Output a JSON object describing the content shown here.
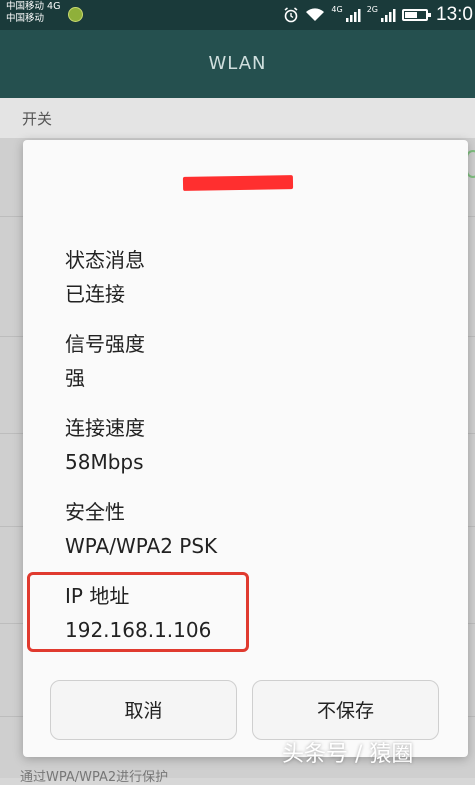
{
  "status_bar": {
    "carrier_line1": "中国移动 4G",
    "carrier_line2": "中国移动",
    "network_tag_1": "4G",
    "network_tag_2": "2G",
    "time": "13:0",
    "battery_level": 0.6,
    "icons": [
      "alarm-icon",
      "wifi-icon",
      "signal-icon",
      "signal-icon",
      "battery-icon"
    ]
  },
  "app_bar": {
    "title": "WLAN"
  },
  "background": {
    "switch_label": "开关",
    "footer_text": "通过WPA/WPA2进行保护"
  },
  "dialog": {
    "title": "",
    "fields": [
      {
        "label": "状态消息",
        "value": "已连接"
      },
      {
        "label": "信号强度",
        "value": "强"
      },
      {
        "label": "连接速度",
        "value": "58Mbps"
      },
      {
        "label": "安全性",
        "value": "WPA/WPA2 PSK"
      },
      {
        "label": "IP 地址",
        "value": "192.168.1.106"
      }
    ],
    "cancel_label": "取消",
    "forget_label": "不保存"
  },
  "watermark": "头条号 / 猿圈",
  "colors": {
    "app_bar": "#25504f",
    "status_bar": "#1a3a3a",
    "highlight": "#e03a2f",
    "redaction": "#ff2f2f"
  }
}
